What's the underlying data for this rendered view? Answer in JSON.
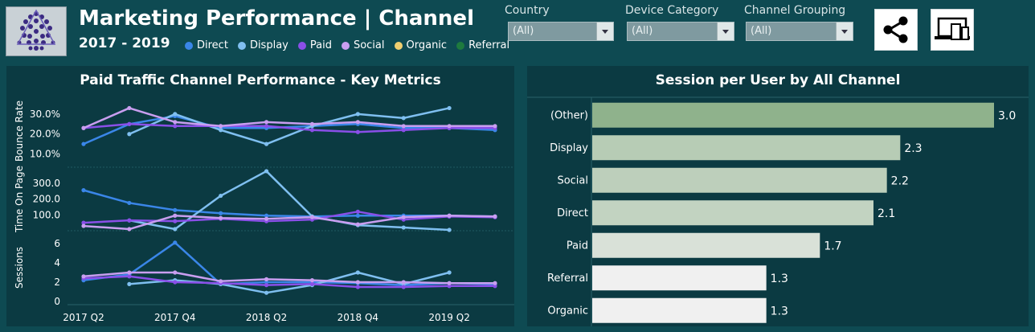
{
  "header": {
    "title": "Marketing Performance | Channel",
    "subtitle": "2017 - 2019"
  },
  "legend": [
    {
      "label": "Direct",
      "color": "#3a86e8"
    },
    {
      "label": "Display",
      "color": "#7fbff0"
    },
    {
      "label": "Paid",
      "color": "#8a4fe8"
    },
    {
      "label": "Social",
      "color": "#c99ef0"
    },
    {
      "label": "Organic",
      "color": "#f0cf70"
    },
    {
      "label": "Referral",
      "color": "#1e7a3e"
    }
  ],
  "filters": [
    {
      "label": "Country",
      "value": "(All)"
    },
    {
      "label": "Device Category",
      "value": "(All)"
    },
    {
      "label": "Channel Grouping",
      "value": "(All)"
    }
  ],
  "icons": {
    "share": "share-icon",
    "devices": "devices-icon"
  },
  "chart_data": [
    {
      "type": "line",
      "title": "Paid Traffic Channel Performance - Key Metrics",
      "x": [
        "2017 Q2",
        "2017 Q3",
        "2017 Q4",
        "2018 Q1",
        "2018 Q2",
        "2018 Q3",
        "2018 Q4",
        "2019 Q1",
        "2019 Q2",
        "2019 Q3"
      ],
      "xticks": [
        "2017 Q2",
        "2017 Q4",
        "2018 Q2",
        "2018 Q4",
        "2019 Q2"
      ],
      "panels": [
        {
          "ylabel": "Bounce Rate",
          "yticks": [
            "10.0%",
            "20.0%",
            "30.0%"
          ],
          "ylim": [
            5,
            38
          ],
          "series": [
            {
              "name": "Direct",
              "values": [
                15,
                25,
                29,
                23,
                23,
                24,
                25,
                23,
                23,
                22
              ]
            },
            {
              "name": "Display",
              "values": [
                null,
                20,
                30,
                22,
                15,
                24,
                30,
                28,
                33,
                null
              ]
            },
            {
              "name": "Paid",
              "values": [
                23,
                25,
                24,
                24,
                24,
                22,
                21,
                22,
                23,
                23
              ]
            },
            {
              "name": "Social",
              "values": [
                23,
                33,
                26,
                24,
                26,
                25,
                26,
                24,
                24,
                24
              ]
            }
          ]
        },
        {
          "ylabel": "Time On Page",
          "yticks": [
            "100.0",
            "200.0",
            "300.0"
          ],
          "ylim": [
            0,
            400
          ],
          "series": [
            {
              "name": "Direct",
              "values": [
                255,
                175,
                130,
                110,
                95,
                90,
                95,
                95,
                95,
                90
              ]
            },
            {
              "name": "Display",
              "values": [
                null,
                65,
                10,
                220,
                375,
                90,
                35,
                20,
                5,
                null
              ]
            },
            {
              "name": "Paid",
              "values": [
                50,
                65,
                60,
                75,
                60,
                70,
                120,
                70,
                90,
                85
              ]
            },
            {
              "name": "Social",
              "values": [
                30,
                10,
                95,
                80,
                75,
                85,
                40,
                85,
                95,
                90
              ]
            }
          ]
        },
        {
          "ylabel": "Sessions",
          "yticks": [
            "0",
            "2",
            "4",
            "6"
          ],
          "ylim": [
            0,
            7
          ],
          "series": [
            {
              "name": "Direct",
              "values": [
                2.2,
                2.8,
                6.1,
                1.8,
                2.0,
                2.0,
                1.9,
                1.7,
                1.9,
                1.8
              ]
            },
            {
              "name": "Display",
              "values": [
                null,
                1.8,
                2.2,
                1.8,
                0.9,
                1.7,
                3.0,
                1.8,
                3.0,
                null
              ]
            },
            {
              "name": "Paid",
              "values": [
                2.4,
                2.6,
                2.0,
                1.9,
                1.7,
                1.8,
                1.5,
                1.5,
                1.6,
                1.6
              ]
            },
            {
              "name": "Social",
              "values": [
                2.6,
                3.0,
                3.0,
                2.1,
                2.3,
                2.2,
                2.0,
                2.0,
                1.9,
                1.9
              ]
            }
          ]
        }
      ]
    },
    {
      "type": "bar",
      "title": "Session per User by All Channel",
      "categories": [
        "(Other)",
        "Display",
        "Social",
        "Direct",
        "Paid",
        "Referral",
        "Organic"
      ],
      "values": [
        3.0,
        2.3,
        2.2,
        2.1,
        1.7,
        1.3,
        1.3
      ],
      "labels": [
        "3.0",
        "2.3",
        "2.2",
        "2.1",
        "1.7",
        "1.3",
        "1.3"
      ],
      "xlim": [
        0,
        3.0
      ]
    }
  ]
}
